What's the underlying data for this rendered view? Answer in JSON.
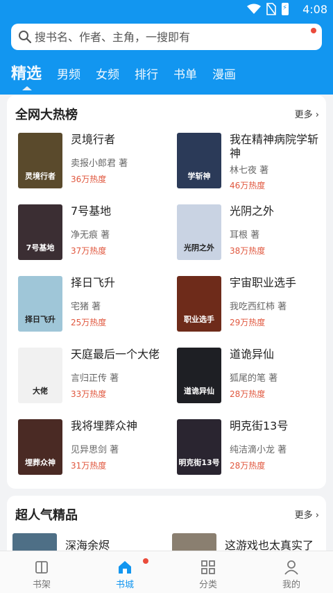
{
  "status_bar": {
    "time": "4:08",
    "icons": [
      "wifi-icon",
      "no-sim-icon",
      "battery-charging-icon"
    ]
  },
  "search": {
    "placeholder": "搜书名、作者、主角，一搜即有"
  },
  "tabs": [
    {
      "label": "精选",
      "active": true
    },
    {
      "label": "男频"
    },
    {
      "label": "女频"
    },
    {
      "label": "排行"
    },
    {
      "label": "书单"
    },
    {
      "label": "漫画"
    }
  ],
  "hot_section": {
    "title": "全网大热榜",
    "more": "更多",
    "books": [
      {
        "title": "灵境行者",
        "author": "卖报小郎君 著",
        "heat": "36万热度",
        "cover_text": "灵境行者",
        "cover_color": "#5a4a2c"
      },
      {
        "title": "我在精神病院学斩神",
        "author": "林七夜 著",
        "heat": "46万热度",
        "cover_text": "学斩神",
        "cover_color": "#2b3a58"
      },
      {
        "title": "7号基地",
        "author": "净无痕 著",
        "heat": "37万热度",
        "cover_text": "7号基地",
        "cover_color": "#3b2e33"
      },
      {
        "title": "光阴之外",
        "author": "耳根 著",
        "heat": "38万热度",
        "cover_text": "光阴之外",
        "cover_color": "#c9d3e3"
      },
      {
        "title": "择日飞升",
        "author": "宅猪 著",
        "heat": "25万热度",
        "cover_text": "择日飞升",
        "cover_color": "#9fc6d8"
      },
      {
        "title": "宇宙职业选手",
        "author": "我吃西红柿 著",
        "heat": "29万热度",
        "cover_text": "职业选手",
        "cover_color": "#6e2b1a"
      },
      {
        "title": "天庭最后一个大佬",
        "author": "言归正传 著",
        "heat": "33万热度",
        "cover_text": "大佬",
        "cover_color": "#f1f1f1"
      },
      {
        "title": "道诡异仙",
        "author": "狐尾的笔 著",
        "heat": "28万热度",
        "cover_text": "道诡异仙",
        "cover_color": "#1e1f24"
      },
      {
        "title": "我将埋葬众神",
        "author": "见异思剑 著",
        "heat": "31万热度",
        "cover_text": "埋葬众神",
        "cover_color": "#4a2a24"
      },
      {
        "title": "明克街13号",
        "author": "纯洁滴小龙 著",
        "heat": "28万热度",
        "cover_text": "明克街13号",
        "cover_color": "#2a2530"
      }
    ]
  },
  "popular_section": {
    "title": "超人气精品",
    "more": "更多",
    "books": [
      {
        "title": "深海余烬",
        "cover_color": "#4e6f86"
      },
      {
        "title": "这游戏也太真实了",
        "cover_color": "#8a7f70"
      }
    ]
  },
  "bottom_nav": [
    {
      "label": "书架",
      "icon": "bookshelf-icon"
    },
    {
      "label": "书城",
      "icon": "bookstore-home-icon",
      "active": true
    },
    {
      "label": "分类",
      "icon": "category-grid-icon"
    },
    {
      "label": "我的",
      "icon": "profile-icon"
    }
  ],
  "colors": {
    "primary": "#1296f0",
    "heat": "#e0573e",
    "badge": "#ea4b3b"
  }
}
